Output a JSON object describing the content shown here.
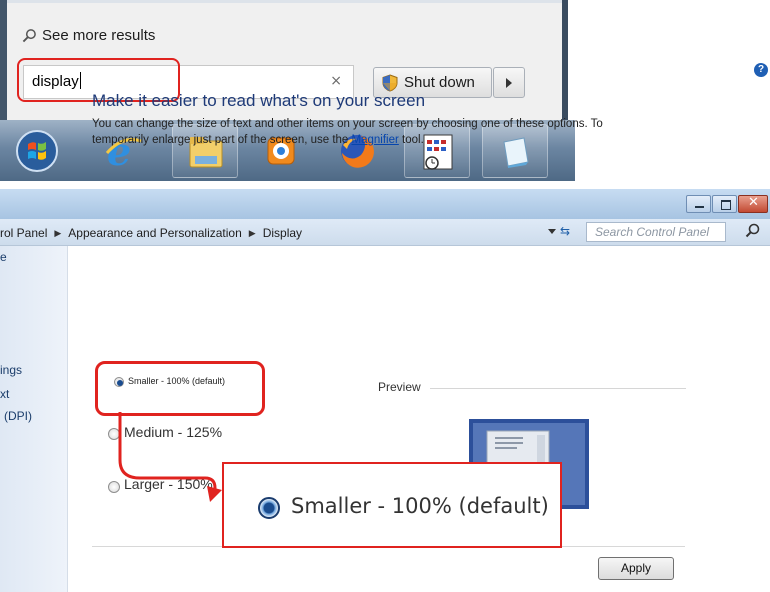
{
  "start_menu": {
    "see_more_results": "See more results",
    "search_value": "display",
    "search_clear": "×",
    "shutdown_label": "Shut down",
    "taskbar_items": [
      {
        "icon": "windows-orb-icon"
      },
      {
        "icon": "internet-explorer-icon"
      },
      {
        "icon": "file-explorer-icon"
      },
      {
        "icon": "media-player-icon"
      },
      {
        "icon": "firefox-icon"
      },
      {
        "icon": "calendar-app-icon"
      },
      {
        "icon": "notepad-icon"
      }
    ]
  },
  "window": {
    "breadcrumb": [
      "Control Panel",
      "Appearance and Personalization",
      "Display"
    ],
    "breadcrumb_visible": [
      "rol Panel",
      "Appearance and Personalization",
      "Display"
    ],
    "search_placeholder": "Search Control Panel",
    "sidebar_fragments": [
      "e",
      "ings",
      "xt",
      "(DPI)"
    ],
    "heading": "Make it easier to read what's on your screen",
    "description_1": "You can change the size of text and other items on your screen by choosing one of these options. To",
    "description_2a": "temporarily enlarge just part of the screen, use the ",
    "magnifier_link": "Magnifier",
    "description_2b": " tool.",
    "options": [
      {
        "label": "Smaller - 100% (default)",
        "selected": true
      },
      {
        "label": "Medium - 125%",
        "selected": false
      },
      {
        "label": "Larger - 150%",
        "selected": false
      }
    ],
    "preview_label": "Preview",
    "apply_label": "Apply",
    "zoom_callout_label": "Smaller - 100% (default)"
  },
  "colors": {
    "highlight": "#e0231f",
    "heading": "#1e3a78",
    "link": "#0645ad"
  }
}
